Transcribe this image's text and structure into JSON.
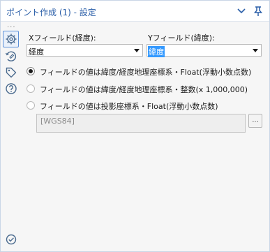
{
  "window": {
    "title": "ポイント作成 (1) - 設定"
  },
  "sidebar": {
    "more_dots": "···",
    "icons": [
      "gear-icon",
      "annotation-icon",
      "tag-icon",
      "help-icon",
      "check-circle-icon"
    ]
  },
  "x_field": {
    "label": "Xフィールド(経度):",
    "value": "経度"
  },
  "y_field": {
    "label": "Yフィールド(緯度):",
    "value": "緯度"
  },
  "options": [
    {
      "label": "フィールドの値は緯度/経度地理座標系・Float(浮動小数点数)",
      "checked": true
    },
    {
      "label": "フィールドの値は緯度/経度地理座標系・整数(x 1,000,000)",
      "checked": false
    },
    {
      "label": "フィールドの値は投影座標系・Float(浮動小数点数)",
      "checked": false
    }
  ],
  "projection": {
    "value": "[WGS84]",
    "browse_label": "..."
  },
  "colors": {
    "title": "#2a5ea8",
    "accent": "#3399ff",
    "icon": "#4a6a8e"
  }
}
